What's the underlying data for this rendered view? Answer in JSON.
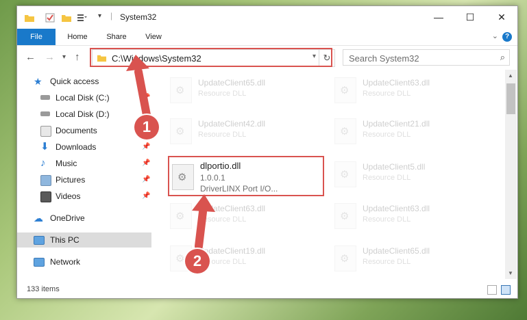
{
  "window": {
    "title": "System32",
    "controls": {
      "minimize": "—",
      "maximize": "☐",
      "close": "✕"
    }
  },
  "ribbon": {
    "tabs": [
      {
        "label": "File"
      },
      {
        "label": "Home"
      },
      {
        "label": "Share"
      },
      {
        "label": "View"
      }
    ],
    "help": "?"
  },
  "address": {
    "path": "C:\\Windows\\System32",
    "search_placeholder": "Search System32"
  },
  "nav": {
    "items": [
      {
        "label": "Quick access"
      },
      {
        "label": "Local Disk (C:)"
      },
      {
        "label": "Local Disk (D:)"
      },
      {
        "label": "Documents"
      },
      {
        "label": "Downloads"
      },
      {
        "label": "Music"
      },
      {
        "label": "Pictures"
      },
      {
        "label": "Videos"
      },
      {
        "label": "OneDrive"
      },
      {
        "label": "This PC"
      },
      {
        "label": "Network"
      }
    ]
  },
  "files": [
    {
      "name": "UpdateClient65.dll",
      "desc": "Resource DLL"
    },
    {
      "name": "UpdateClient63.dll",
      "desc": "Resource DLL"
    },
    {
      "name": "UpdateClient42.dll",
      "desc": "Resource DLL"
    },
    {
      "name": "UpdateClient21.dll",
      "desc": "Resource DLL"
    },
    {
      "name": "dlportio.dll",
      "version": "1.0.0.1",
      "desc": "DriverLINX Port I/O..."
    },
    {
      "name": "UpdateClient5.dll",
      "desc": "Resource DLL"
    },
    {
      "name": "UpdateClient63.dll",
      "desc": "Resource DLL"
    },
    {
      "name": "UpdateClient63.dll",
      "desc": "Resource DLL"
    },
    {
      "name": "UpdateClient19.dll",
      "desc": "Resource DLL"
    },
    {
      "name": "UpdateClient65.dll",
      "desc": "Resource DLL"
    }
  ],
  "status": {
    "count": "133 items"
  },
  "annotations": {
    "step1": "1",
    "step2": "2"
  },
  "colors": {
    "accent": "#1979ca",
    "highlight": "#d9534f"
  }
}
